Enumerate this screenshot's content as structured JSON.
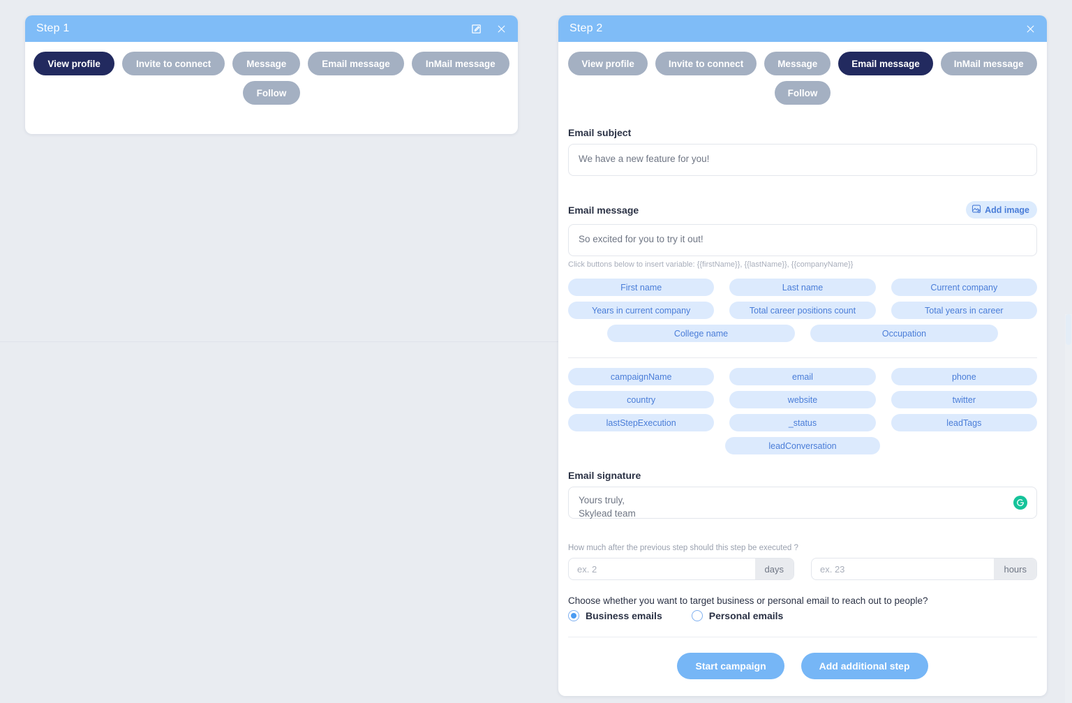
{
  "step1": {
    "title": "Step 1",
    "icons": {
      "edit": "edit-square-icon",
      "close": "close-icon"
    },
    "actions_row1": [
      {
        "label": "View profile",
        "selected": true
      },
      {
        "label": "Invite to connect",
        "selected": false
      },
      {
        "label": "Message",
        "selected": false
      },
      {
        "label": "Email message",
        "selected": false
      },
      {
        "label": "InMail message",
        "selected": false
      }
    ],
    "actions_row2": [
      {
        "label": "Follow",
        "selected": false
      }
    ]
  },
  "step2": {
    "title": "Step 2",
    "icons": {
      "close": "close-icon"
    },
    "actions_row1": [
      {
        "label": "View profile",
        "selected": false
      },
      {
        "label": "Invite to connect",
        "selected": false
      },
      {
        "label": "Message",
        "selected": false
      },
      {
        "label": "Email message",
        "selected": true
      },
      {
        "label": "InMail message",
        "selected": false
      }
    ],
    "actions_row2": [
      {
        "label": "Follow",
        "selected": false
      }
    ],
    "email_subject": {
      "label": "Email subject",
      "value": "We have a new feature for you!"
    },
    "email_message": {
      "label": "Email message",
      "value": "So excited for you to try it out!",
      "add_image_label": "Add image",
      "hint": "Click buttons below to insert variable: {{firstName}}, {{lastName}}, {{companyName}}"
    },
    "variables_group1": [
      "First name",
      "Last name",
      "Current company",
      "Years in current company",
      "Total career positions count",
      "Total years in career"
    ],
    "variables_group1_row3": [
      "College name",
      "Occupation"
    ],
    "variables_group2": [
      "campaignName",
      "email",
      "phone",
      "country",
      "website",
      "twitter",
      "lastStepExecution",
      "_status",
      "leadTags"
    ],
    "variables_group2_row4": [
      "leadConversation"
    ],
    "email_signature": {
      "label": "Email signature",
      "value": "Yours truly,\nSkylead team",
      "assistant_icon": "grammarly-icon"
    },
    "timing": {
      "question": "How much after the previous step should this step be executed ?",
      "days_placeholder": "ex. 2",
      "days_value": "",
      "days_suffix": "days",
      "hours_placeholder": "ex. 23",
      "hours_value": "",
      "hours_suffix": "hours"
    },
    "target": {
      "question": "Choose whether you want to target business or personal email to reach out to people?",
      "options": [
        {
          "label": "Business emails",
          "selected": true
        },
        {
          "label": "Personal emails",
          "selected": false
        }
      ]
    },
    "footer": {
      "start_campaign": "Start campaign",
      "add_step": "Add additional step"
    }
  },
  "colors": {
    "header_blue": "#7fbcf7",
    "selected_navy": "#222a5f",
    "unselected_gray": "#a4b0c2",
    "chip_bg": "#dceafd",
    "chip_text": "#4a7dd8",
    "primary_button": "#76b6f6",
    "page_bg": "#e9ecf1",
    "grammarly_green": "#15c39a"
  }
}
